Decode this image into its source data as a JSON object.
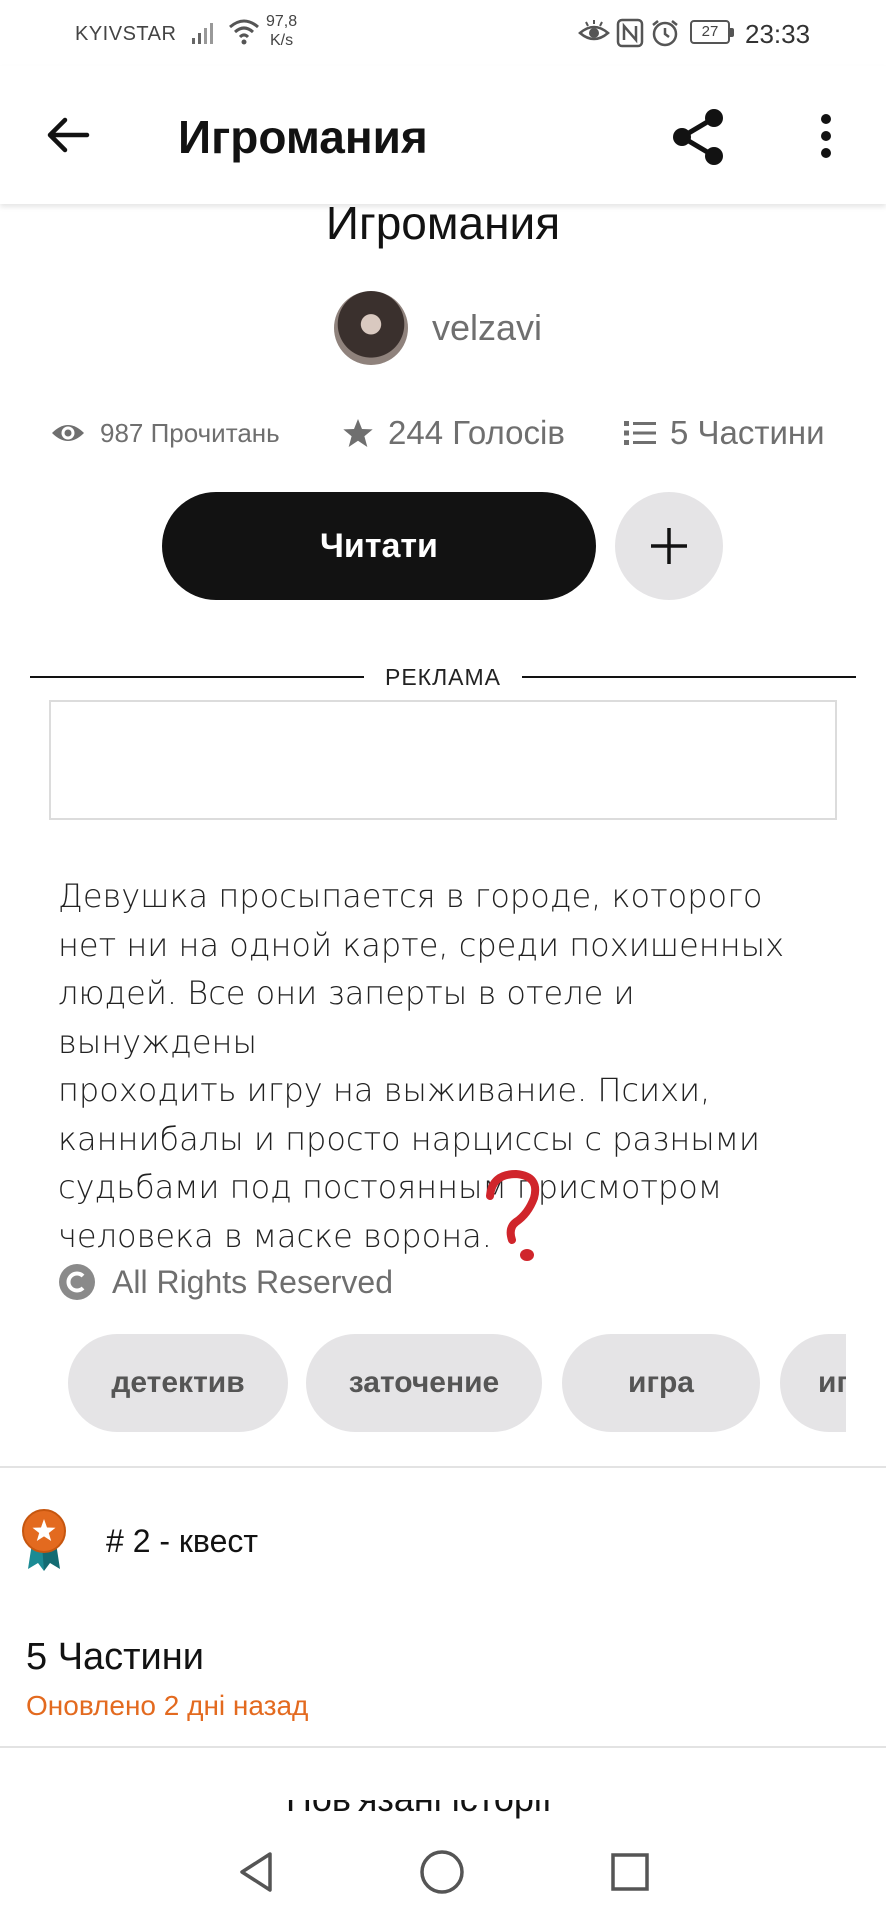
{
  "status_bar": {
    "carrier": "KYIVSTAR",
    "speed_value": "97,8",
    "speed_unit": "K/s",
    "battery": "27",
    "time": "23:33"
  },
  "app_bar": {
    "title": "Игромания",
    "icons": [
      "arrow-left-icon",
      "share-icon",
      "more-vert-icon"
    ]
  },
  "story": {
    "title": "Игромания",
    "author": "velzavi",
    "stats": {
      "reads": "987 Прочитань",
      "votes": "244 Голосів",
      "parts": "5 Частини"
    },
    "read_button": "Читати",
    "ad_label": "РЕКЛАМА",
    "description_lines": [
      "Девушка просыпается в городе, которого",
      "нет ни на одной карте, среди похишенных",
      "людей.  Все они заперты в отеле и вынуждены",
      "проходить игру на выживание. Психи,",
      "каннибалы и просто нарциссы с разными",
      "судьбами под постоянным присмотром",
      "человека в маске ворона."
    ],
    "license": "All Rights Reserved",
    "tags": [
      "детектив",
      "заточение",
      "игра",
      "иг"
    ],
    "rank": "# 2 - квест",
    "parts_title": "5 Частини",
    "updated": "Оновлено 2 дні назад",
    "cut_off_text": "Пов'язані історії"
  },
  "colors": {
    "accent_orange": "#e36a1f",
    "button_dark": "#121212",
    "chip_gray": "#e5e4e6",
    "annotation_red": "#d0252b"
  },
  "nav_bar": {
    "icons": [
      "back-triangle-icon",
      "home-circle-icon",
      "recents-square-icon"
    ]
  }
}
